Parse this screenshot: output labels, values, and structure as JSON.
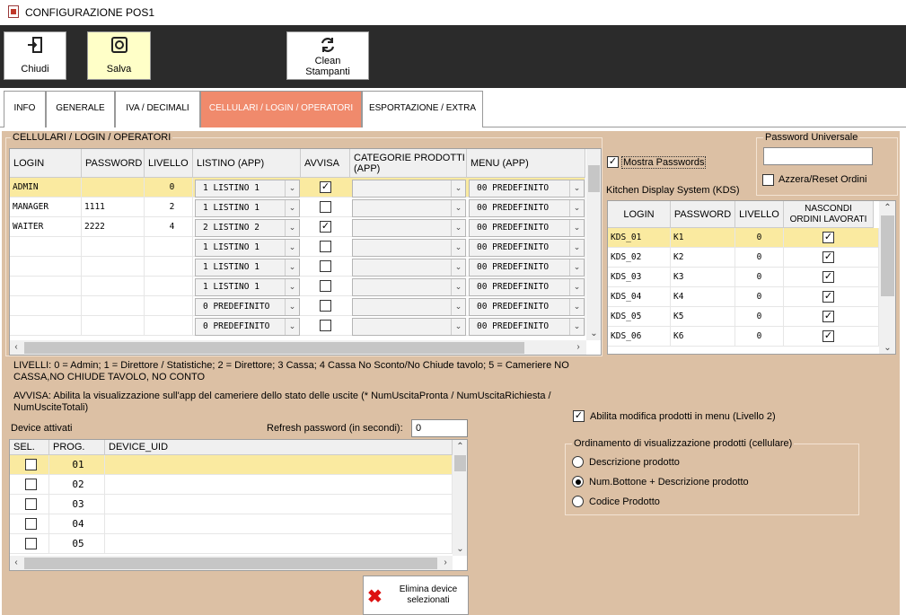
{
  "window": {
    "title": "CONFIGURAZIONE POS1"
  },
  "toolbar": {
    "close_label": "Chiudi",
    "save_label": "Salva",
    "clean_label_1": "Clean",
    "clean_label_2": "Stampanti"
  },
  "tabs": [
    {
      "label": "INFO"
    },
    {
      "label": "GENERALE"
    },
    {
      "label": "IVA / DECIMALI"
    },
    {
      "label": "CELLULARI / LOGIN / OPERATORI"
    },
    {
      "label": "ESPORTAZIONE / EXTRA"
    }
  ],
  "operators": {
    "group_title": "CELLULARI / LOGIN / OPERATORI",
    "headers": {
      "login": "LOGIN",
      "password": "PASSWORD",
      "livello": "LIVELLO",
      "listino": "LISTINO (APP)",
      "avvisa": "AVVISA",
      "categorie_1": "CATEGORIE PRODOTTI",
      "categorie_2": "(APP)",
      "menu": "MENU (APP)"
    },
    "rows": [
      {
        "login": "ADMIN",
        "password": "",
        "livello": "0",
        "listino": "1 LISTINO 1",
        "avvisa": true,
        "menu": "00 PREDEFINITO"
      },
      {
        "login": "MANAGER",
        "password": "1111",
        "livello": "2",
        "listino": "1 LISTINO 1",
        "avvisa": false,
        "menu": "00 PREDEFINITO"
      },
      {
        "login": "WAITER",
        "password": "2222",
        "livello": "4",
        "listino": "2 LISTINO 2",
        "avvisa": true,
        "menu": "00 PREDEFINITO"
      },
      {
        "login": "",
        "password": "",
        "livello": "",
        "listino": "1 LISTINO 1",
        "avvisa": false,
        "menu": "00 PREDEFINITO"
      },
      {
        "login": "",
        "password": "",
        "livello": "",
        "listino": "1 LISTINO 1",
        "avvisa": false,
        "menu": "00 PREDEFINITO"
      },
      {
        "login": "",
        "password": "",
        "livello": "",
        "listino": "1 LISTINO 1",
        "avvisa": false,
        "menu": "00 PREDEFINITO"
      },
      {
        "login": "",
        "password": "",
        "livello": "",
        "listino": "0 PREDEFINITO",
        "avvisa": false,
        "menu": "00 PREDEFINITO"
      },
      {
        "login": "",
        "password": "",
        "livello": "",
        "listino": "0 PREDEFINITO",
        "avvisa": false,
        "menu": "00 PREDEFINITO"
      }
    ]
  },
  "options": {
    "show_passwords_label": "Mostra Passwords",
    "universal_password_label": "Password Universale",
    "reset_orders_label": "Azzera/Reset Ordini"
  },
  "kds": {
    "title": "Kitchen Display System (KDS)",
    "headers": {
      "login": "LOGIN",
      "password": "PASSWORD",
      "livello": "LIVELLO",
      "nascondi_1": "NASCONDI",
      "nascondi_2": "ORDINI LAVORATI"
    },
    "rows": [
      {
        "login": "KDS_01",
        "password": "K1",
        "livello": "0"
      },
      {
        "login": "KDS_02",
        "password": "K2",
        "livello": "0"
      },
      {
        "login": "KDS_03",
        "password": "K3",
        "livello": "0"
      },
      {
        "login": "KDS_04",
        "password": "K4",
        "livello": "0"
      },
      {
        "login": "KDS_05",
        "password": "K5",
        "livello": "0"
      },
      {
        "login": "KDS_06",
        "password": "K6",
        "livello": "0"
      }
    ]
  },
  "notes": {
    "livelli_1": "LIVELLI: 0 = Admin; 1 = Direttore / Statistiche; 2 = Direttore; 3 Cassa; 4 Cassa No Sconto/No Chiude tavolo; 5 = Cameriere NO",
    "livelli_2": "CASSA,NO CHIUDE TAVOLO, NO CONTO",
    "avvisa_1": "AVVISA: Abilita la visualizzazione sull'app del cameriere dello stato delle uscite (* NumUscitaPronta / NumUscitaRichiesta /",
    "avvisa_2": "NumUsciteTotali)"
  },
  "devices": {
    "title": "Device attivati",
    "refresh_label": "Refresh password (in secondi):",
    "refresh_value": "0",
    "headers": {
      "sel": "SEL.",
      "prog": "PROG.",
      "uid": "DEVICE_UID"
    },
    "rows": [
      {
        "prog": "01"
      },
      {
        "prog": "02"
      },
      {
        "prog": "03"
      },
      {
        "prog": "04"
      },
      {
        "prog": "05"
      }
    ],
    "delete_label_1": "Elimina device",
    "delete_label_2": "selezionati"
  },
  "menu_edit": {
    "label": "Abilita modifica prodotti in menu (Livello 2)"
  },
  "ordering": {
    "title": "Ordinamento di visualizzazione prodotti (cellulare)",
    "options": [
      {
        "label": "Descrizione prodotto"
      },
      {
        "label": "Num.Bottone + Descrizione prodotto"
      },
      {
        "label": "Codice Prodotto"
      }
    ]
  },
  "colors": {
    "accent_tab": "#f08a6c",
    "panel_bg": "#dcc0a4",
    "selected_row": "#faeaa0",
    "toolbar_bg": "#2b2b2b"
  }
}
